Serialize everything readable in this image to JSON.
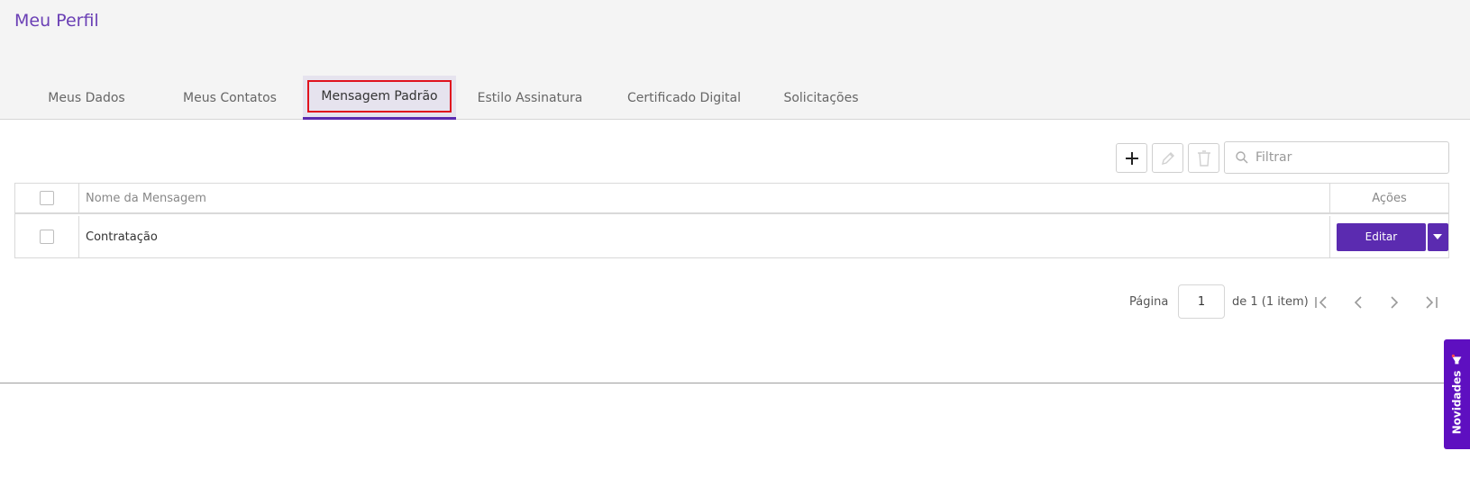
{
  "header": {
    "title": "Meu Perfil"
  },
  "tabs": [
    {
      "label": "Meus Dados"
    },
    {
      "label": "Meus Contatos"
    },
    {
      "label": "Mensagem Padrão",
      "active": true
    },
    {
      "label": "Estilo Assinatura"
    },
    {
      "label": "Certificado Digital"
    },
    {
      "label": "Solicitações"
    }
  ],
  "toolbar": {
    "add_icon": "plus-icon",
    "edit_icon": "pencil-icon",
    "delete_icon": "trash-icon",
    "filter_placeholder": "Filtrar"
  },
  "table": {
    "columns": {
      "name": "Nome da Mensagem",
      "actions": "Ações"
    },
    "rows": [
      {
        "name": "Contratação",
        "action_label": "Editar"
      }
    ]
  },
  "pagination": {
    "page_label": "Página",
    "current_page": "1",
    "of_label": "de 1 (1 item)"
  },
  "side_tab": {
    "label": "Novidades"
  },
  "colors": {
    "accent": "#5b2bb0",
    "title": "#6a3fb5",
    "highlight": "#e0131e",
    "side_tab": "#5e0fc0"
  }
}
